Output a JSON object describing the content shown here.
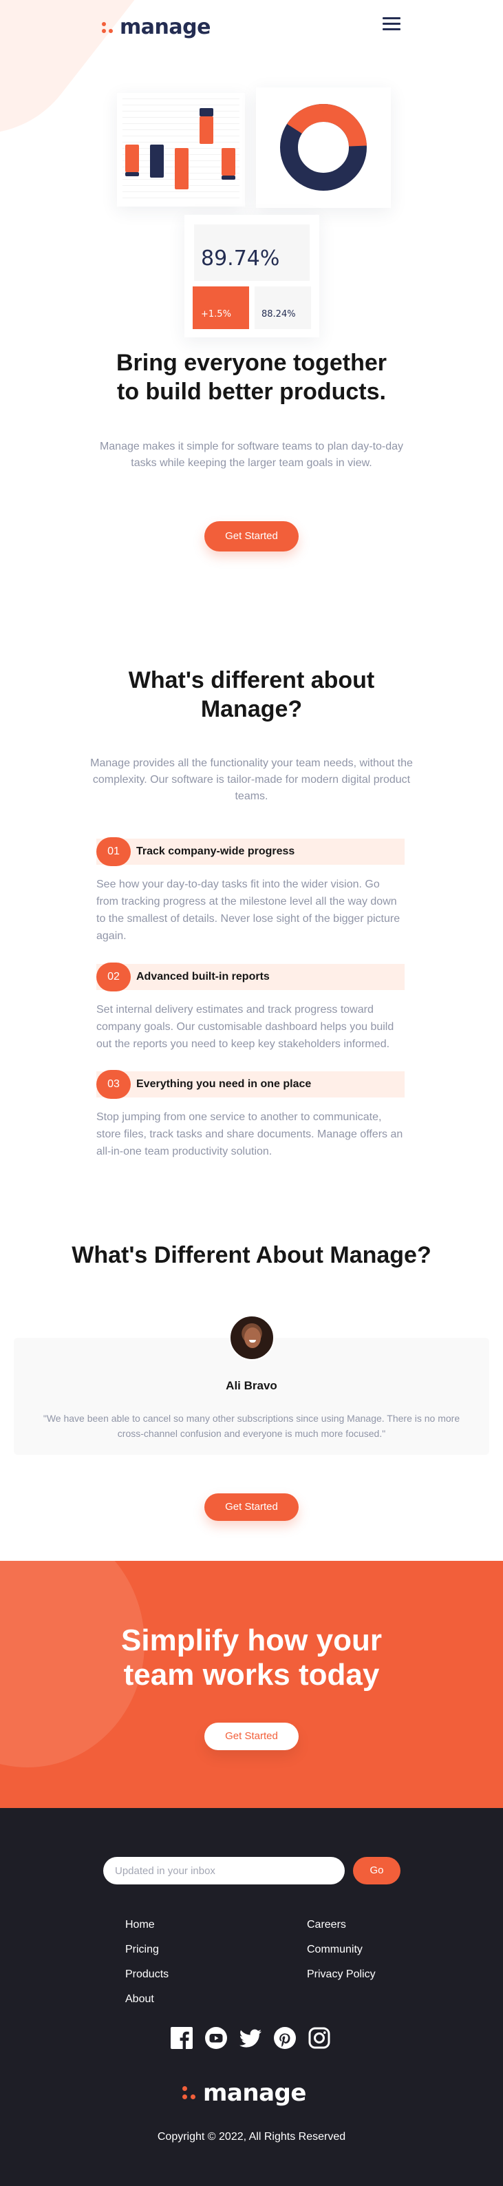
{
  "header": {
    "logo_text": "manage",
    "menu_icon": "hamburger-menu-icon"
  },
  "hero": {
    "stat_big": "89.74%",
    "stat_change": "+1.5%",
    "stat_small": "88.24%",
    "title_line1": "Bring everyone together",
    "title_line2": "to build better products.",
    "subtitle": "Manage makes it simple for software teams to plan day-to-day tasks while keeping the larger team goals in view.",
    "cta_label": "Get Started"
  },
  "features": {
    "title_line1": "What's different about",
    "title_line2": "Manage?",
    "subtitle": "Manage provides all the functionality your team needs, without the complexity. Our software is tailor-made for modern digital product teams.",
    "items": [
      {
        "num": "01",
        "name": "Track company-wide progress",
        "desc": "See how your day-to-day tasks fit into the wider vision. Go from tracking progress at the milestone level all the way down to the smallest of details. Never lose sight of the bigger picture again."
      },
      {
        "num": "02",
        "name": "Advanced built-in reports",
        "desc": "Set internal delivery estimates and track progress toward company goals. Our customisable dashboard helps you build out the reports you need to keep key stakeholders informed."
      },
      {
        "num": "03",
        "name": "Everything you need in one place",
        "desc": "Stop jumping from one service to another to communicate, store files, track tasks and share documents. Manage offers an all-in-one team productivity solution."
      }
    ]
  },
  "testimonials": {
    "title": "What's Different About Manage?",
    "name": "Ali Bravo",
    "quote": "\"We have been able to cancel so many other subscriptions since using Manage. There is no more cross-channel confusion and everyone is much more focused.\"",
    "cta_label": "Get Started"
  },
  "cta": {
    "title_line1": "Simplify how your",
    "title_line2": "team works today",
    "button_label": "Get Started"
  },
  "footer": {
    "newsletter_placeholder": "Updated in your inbox",
    "go_label": "Go",
    "links_col1": [
      "Home",
      "Pricing",
      "Products",
      "About"
    ],
    "links_col2": [
      "Careers",
      "Community",
      "Privacy Policy"
    ],
    "social_icons": [
      "facebook-icon",
      "youtube-icon",
      "twitter-icon",
      "pinterest-icon",
      "instagram-icon"
    ],
    "logo_text": "manage",
    "copyright": "Copyright © 2022, All Rights Reserved"
  },
  "colors": {
    "accent": "#f25f3a",
    "navy": "#242d52",
    "footer_bg": "#1e1e26",
    "tint": "#fff1ec"
  }
}
